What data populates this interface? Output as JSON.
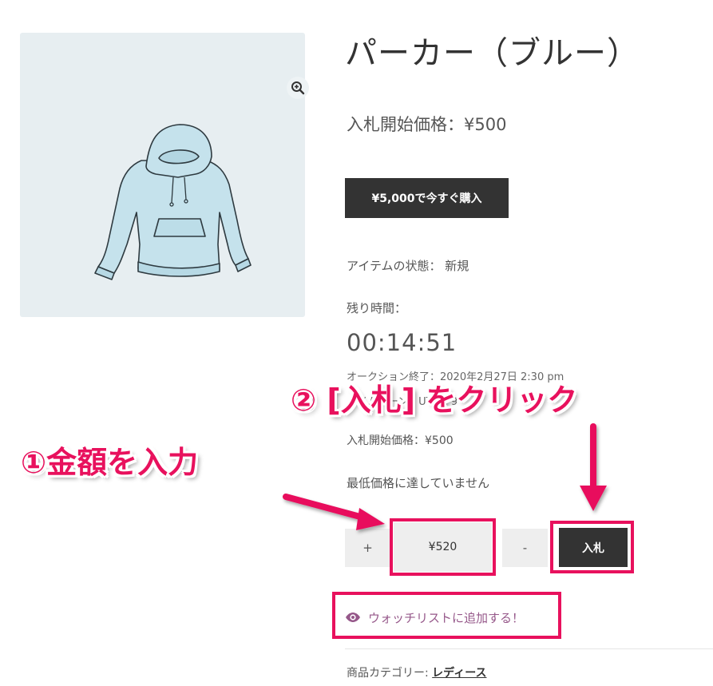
{
  "product": {
    "title": "パーカー（ブルー）",
    "start_price_heading": "入札開始価格：¥500",
    "buy_now_label": "¥5,000で今すぐ購入",
    "condition": "アイテムの状態： 新規",
    "time_left_label": "残り時間：",
    "countdown": "00:14:51",
    "ending_text": "オークション終了：2020年2月27日 2:30 pm",
    "timezone_text": "タイムゾーン：UTC +9",
    "start_price_line": "入札開始価格：¥500",
    "reserve_text": "最低価格に達していません"
  },
  "bid": {
    "plus_label": "+",
    "amount": "¥520",
    "minus_label": "-",
    "bid_label": "入札"
  },
  "watchlist_label": "ウォッチリストに追加する！",
  "category": {
    "prefix": "商品カテゴリー:",
    "link": "レディース"
  },
  "annotations": {
    "step1": "①金額を入力",
    "step2": "② [入札] をクリック"
  },
  "icons": {
    "zoom": "zoom-in-icon",
    "eye": "eye-icon"
  },
  "colors": {
    "highlight": "#e8115d",
    "dark_button": "#333333",
    "link_purple": "#96588a",
    "image_bg": "#e7eef1"
  }
}
